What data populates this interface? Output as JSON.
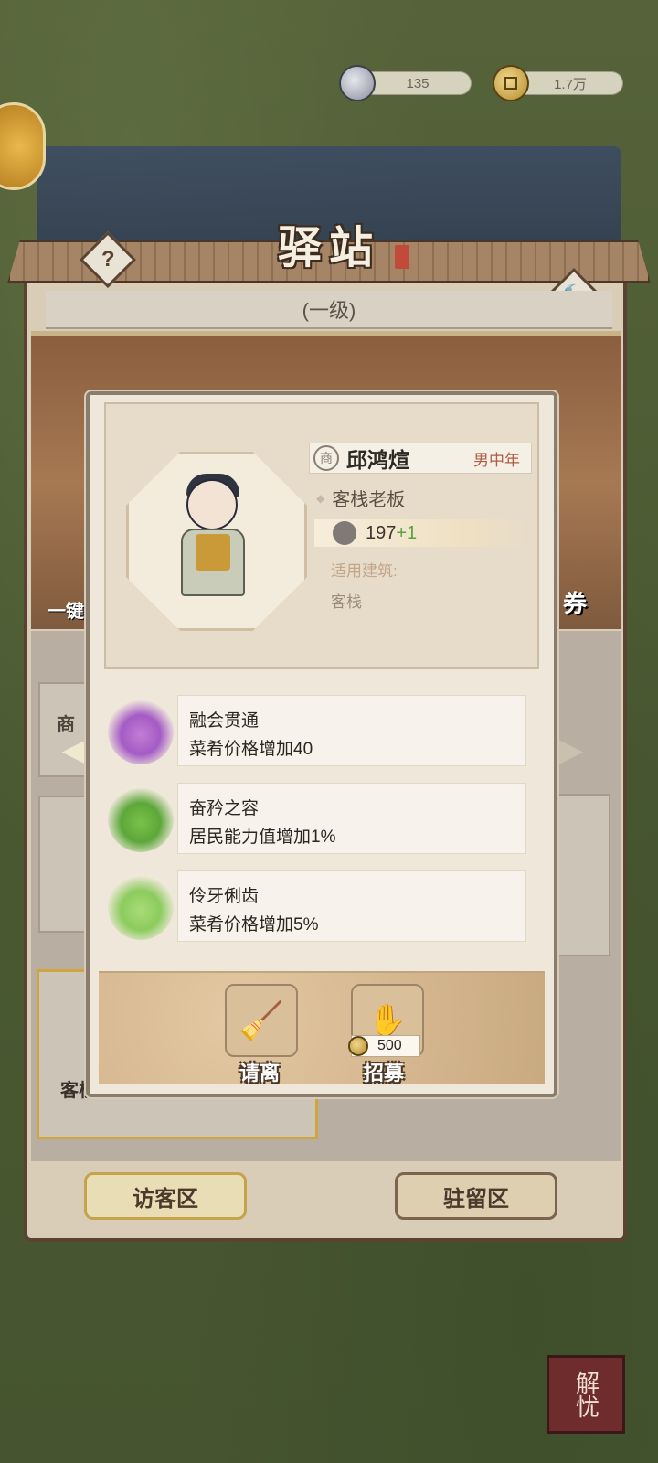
{
  "currencies": {
    "silver": "135",
    "coins": "1.7万"
  },
  "building": {
    "title": "驿站",
    "level": "(一级)",
    "help": "?",
    "build": "🔨"
  },
  "background_labels": {
    "left_button_fragment": "一键",
    "right_button_fragment": "券",
    "left_card_fragment": "商",
    "left_card_fragment2": "客栈"
  },
  "popup": {
    "name_badge": "商",
    "name": "邱鸿煊",
    "gender_age": "男中年",
    "role": "客栈老板",
    "power": "197",
    "power_bonus": "+1",
    "applicable_label": "适用建筑:",
    "applicable_value": "客栈",
    "skills": [
      {
        "name": "融会贯通",
        "desc": "菜肴价格增加40",
        "icon": "purple-bowl-icon"
      },
      {
        "name": "奋矜之容",
        "desc": "居民能力值增加1%",
        "icon": "green-person-icon"
      },
      {
        "name": "伶牙俐齿",
        "desc": "菜肴价格增加5%",
        "icon": "green-plate-icon"
      }
    ],
    "dismiss_label": "请离",
    "recruit_label": "招募",
    "recruit_cost": "500"
  },
  "tabs": {
    "visitor": "访客区",
    "resident": "驻留区"
  },
  "corner_seal": "解忧",
  "colors": {
    "panel_border": "#5b4331",
    "accent_gold": "#c5a24c",
    "bonus_green": "#57a33c"
  }
}
